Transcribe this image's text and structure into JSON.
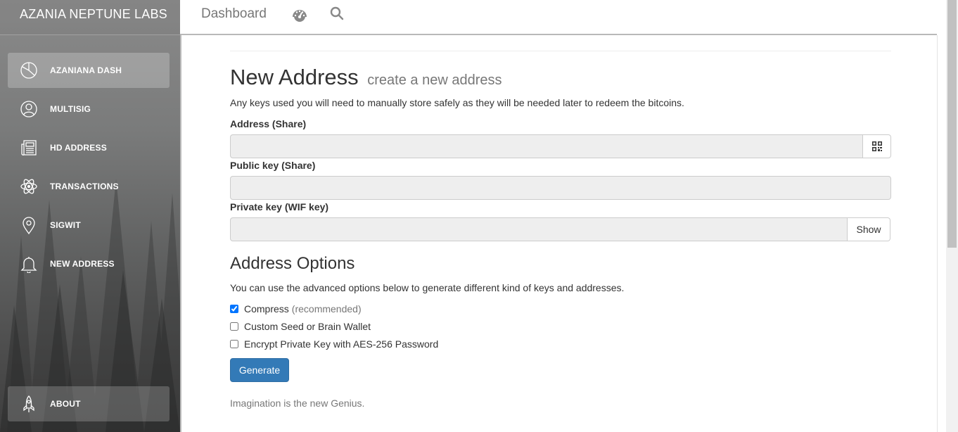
{
  "sidebar": {
    "brand": "AZANIA NEPTUNE LABS",
    "items": [
      {
        "label": "AZANIANA DASH",
        "icon": "pie-chart-icon",
        "active": true
      },
      {
        "label": "MULTISIG",
        "icon": "user-circle-icon"
      },
      {
        "label": "HD ADDRESS",
        "icon": "newspaper-icon"
      },
      {
        "label": "TRANSACTIONS",
        "icon": "atom-icon"
      },
      {
        "label": "SIGWIT",
        "icon": "map-pin-icon"
      },
      {
        "label": "NEW ADDRESS",
        "icon": "bell-icon"
      }
    ],
    "about": {
      "label": "ABOUT",
      "icon": "rocket-icon"
    }
  },
  "topbar": {
    "title": "Dashboard",
    "icons": [
      "dashboard-gauge-icon",
      "search-icon"
    ]
  },
  "main": {
    "heading": "New Address",
    "subheading": "create a new address",
    "intro": "Any keys used you will need to manually store safely as they will be needed later to redeem the bitcoins.",
    "fields": {
      "address": {
        "label": "Address (Share)",
        "value": "",
        "addon_icon": "qr-code-icon"
      },
      "public_key": {
        "label": "Public key (Share)",
        "value": ""
      },
      "private_key": {
        "label": "Private key (WIF key)",
        "value": "",
        "button": "Show"
      }
    },
    "options": {
      "heading": "Address Options",
      "description": "You can use the advanced options below to generate different kind of keys and addresses.",
      "compress": {
        "label": "Compress",
        "note": "(recommended)",
        "checked": true
      },
      "custom_seed": {
        "label": "Custom Seed or Brain Wallet",
        "checked": false
      },
      "encrypt": {
        "label": "Encrypt Private Key with AES-256 Password",
        "checked": false
      }
    },
    "generate_button": "Generate",
    "footer_note": "Imagination is the new Genius."
  },
  "colors": {
    "primary": "#337ab7",
    "muted_text": "#777777",
    "sidebar_text": "#ffffff"
  }
}
